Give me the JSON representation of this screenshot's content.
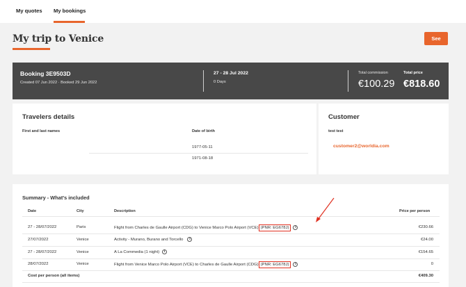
{
  "tabs": [
    {
      "label": "My quotes",
      "active": false
    },
    {
      "label": "My bookings",
      "active": true
    }
  ],
  "page": {
    "title": "My trip to Venice",
    "see_label": "See"
  },
  "booking": {
    "id": "Booking 3E9503D",
    "created_booked": "Created 07 Jun 2022 · Booked 29 Jun 2022",
    "dates": "27 - 28 Jul 2022",
    "days": "0 Days",
    "commission_label": "Total commission",
    "commission_value": "€100.29",
    "price_label": "Total price",
    "price_value": "€818.60"
  },
  "travelers": {
    "title": "Travelers details",
    "col_name": "First and last names",
    "col_dob": "Date of birth",
    "rows": [
      {
        "name": "",
        "dob": "1977-05-11"
      },
      {
        "name": "",
        "dob": "1971-08-18"
      }
    ]
  },
  "customer": {
    "title": "Customer",
    "name": "test test",
    "email": "customer2@worldia.com"
  },
  "summary": {
    "title": "Summary - What's included",
    "headers": {
      "date": "Date",
      "city": "City",
      "description": "Description",
      "price": "Price per person"
    },
    "rows": [
      {
        "date": "27 - 28/07/2022",
        "city": "Paris",
        "description": "Flight from Charles de Gaulle Airport (CDG) to Venice Marco Polo Airport (VCE)",
        "pnr": "(PNR: EG678J)",
        "price": "€230.66"
      },
      {
        "date": "27/07/2022",
        "city": "Venice",
        "description": "Activity - Murano, Burano and Torcello",
        "pnr": "",
        "price": "€24.00"
      },
      {
        "date": "27 - 28/07/2022",
        "city": "Venice",
        "description": "A La Commedia (1 night)",
        "pnr": "",
        "price": "€154.65"
      },
      {
        "date": "28/07/2022",
        "city": "Venice",
        "description": "Flight from Venice Marco Polo Airport (VCE) to Charles de Gaulle Airport (CDG)",
        "pnr": "(PNR: EG678J)",
        "price": "0"
      }
    ],
    "cost_label": "Cost per person (all items)",
    "cost_value": "€409.30"
  },
  "colors": {
    "accent": "#e8652c",
    "banner": "#484848",
    "annotation": "#e03020"
  },
  "icons": [
    "info-icon",
    "annotation-arrow"
  ]
}
